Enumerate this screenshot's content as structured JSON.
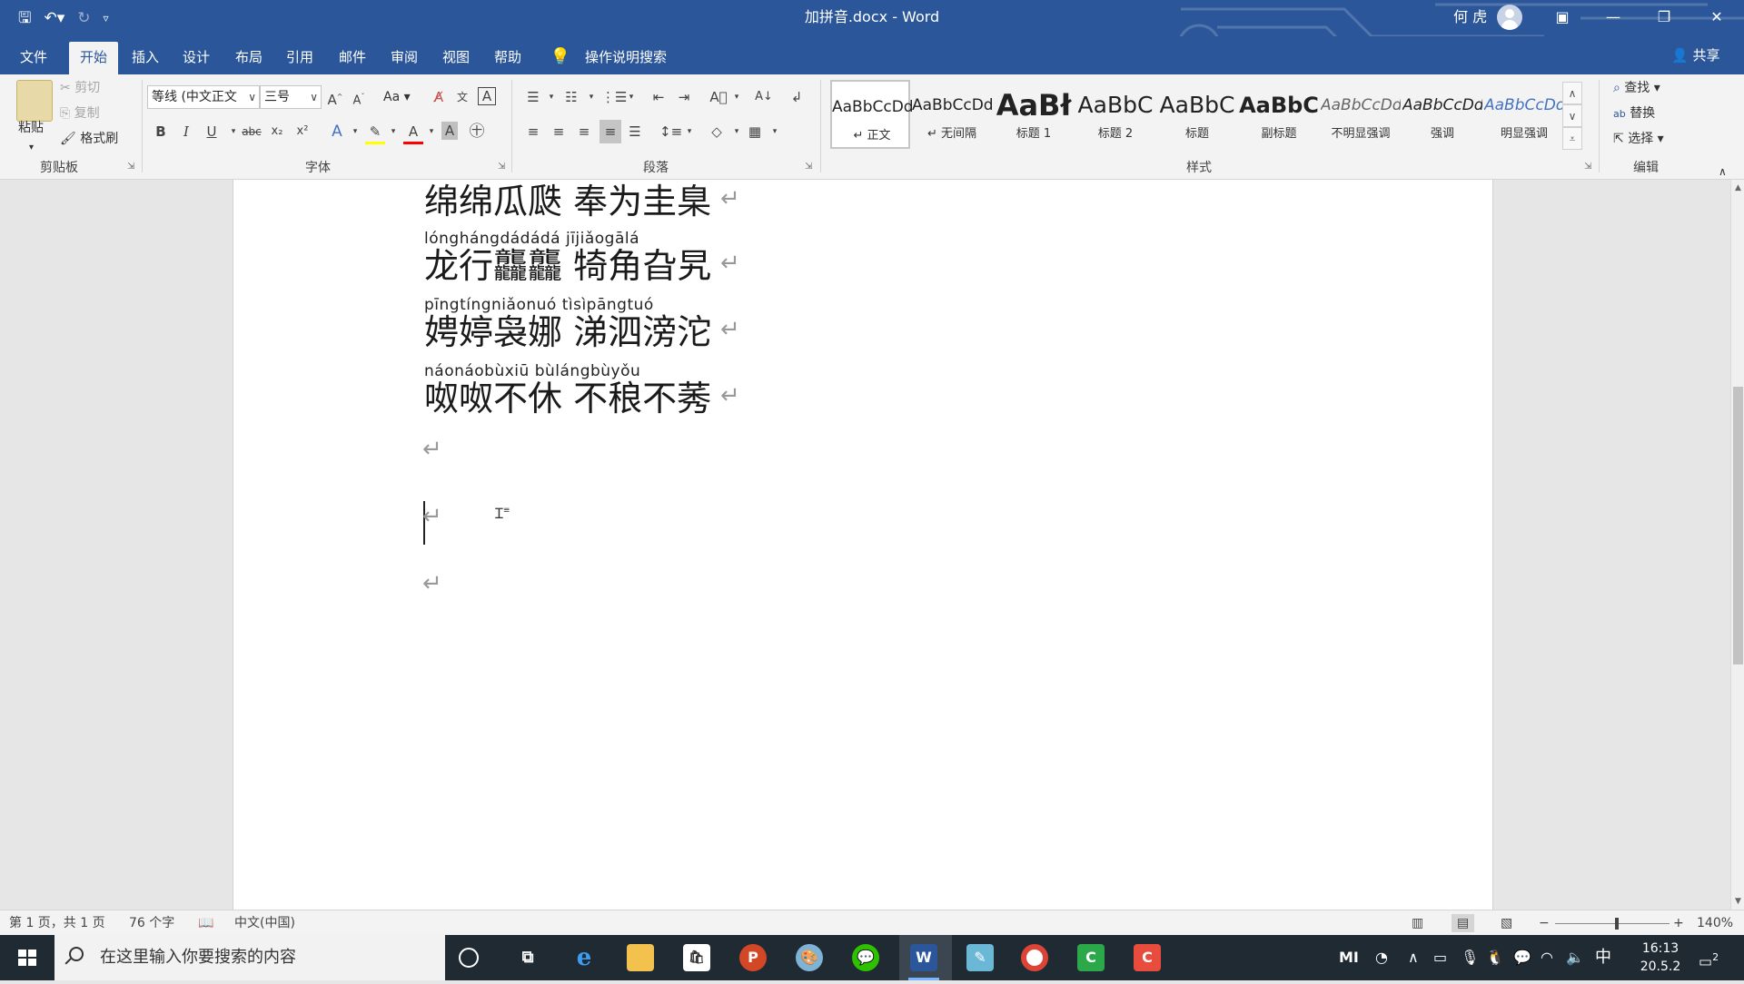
{
  "title_bar": {
    "document_title": "加拼音.docx  -  Word",
    "user_name": "何 虎",
    "icons": [
      "save-icon",
      "undo-icon",
      "redo-icon",
      "customize-qat-icon",
      "ribbon-display-options-icon",
      "minimize-icon",
      "restore-icon",
      "close-icon"
    ]
  },
  "tabs": [
    "文件",
    "开始",
    "插入",
    "设计",
    "布局",
    "引用",
    "邮件",
    "审阅",
    "视图",
    "帮助"
  ],
  "active_tab": "开始",
  "tell_me": "操作说明搜索",
  "share": "共享",
  "clipboard": {
    "paste": "粘贴",
    "cut": "剪切",
    "copy": "复制",
    "format_painter": "格式刷",
    "label": "剪贴板"
  },
  "font": {
    "name": "等线 (中文正文",
    "size": "三号",
    "label": "字体",
    "case_btn": "Aa"
  },
  "paragraph": {
    "label": "段落"
  },
  "styles": {
    "label": "样式",
    "items": [
      {
        "preview": "AaBbCcDd",
        "name": "↵ 正文"
      },
      {
        "preview": "AaBbCcDd",
        "name": "↵ 无间隔"
      },
      {
        "preview": "AaBł",
        "name": "标题 1"
      },
      {
        "preview": "AaBbC",
        "name": "标题 2"
      },
      {
        "preview": "AaBbC",
        "name": "标题"
      },
      {
        "preview": "AaBbC",
        "name": "副标题"
      },
      {
        "preview": "AaBbCcDd",
        "name": "不明显强调"
      },
      {
        "preview": "AaBbCcDd",
        "name": "强调"
      },
      {
        "preview": "AaBbCcDd",
        "name": "明显强调"
      }
    ]
  },
  "editing": {
    "find": "查找",
    "replace": "替换",
    "select": "选择",
    "label": "编辑"
  },
  "document": {
    "lines": [
      {
        "pinyin": "",
        "text": "绵绵瓜瓞  奉为圭臬"
      },
      {
        "pinyin": "lónghángdádádá   jījiǎogālá",
        "text": "龙行龘龘  犄角旮旯"
      },
      {
        "pinyin": "pīngtíngniǎonuó   tìsìpāngtuó",
        "text": "娉婷袅娜  涕泗滂沱"
      },
      {
        "pinyin": "náonáobùxiū   bùlángbùyǒu",
        "text": "呶呶不休  不稂不莠"
      }
    ],
    "paragraph_mark": "↵"
  },
  "status_bar": {
    "page": "第 1 页，共 1 页",
    "words": "76 个字",
    "language": "中文(中国)",
    "zoom": "140%",
    "zoom_minus": "−",
    "zoom_plus": "+"
  },
  "taskbar": {
    "search_placeholder": "在这里输入你要搜索的内容",
    "ime": "中",
    "time": "16:13",
    "date": "20.5.2",
    "notification_count": "2"
  }
}
